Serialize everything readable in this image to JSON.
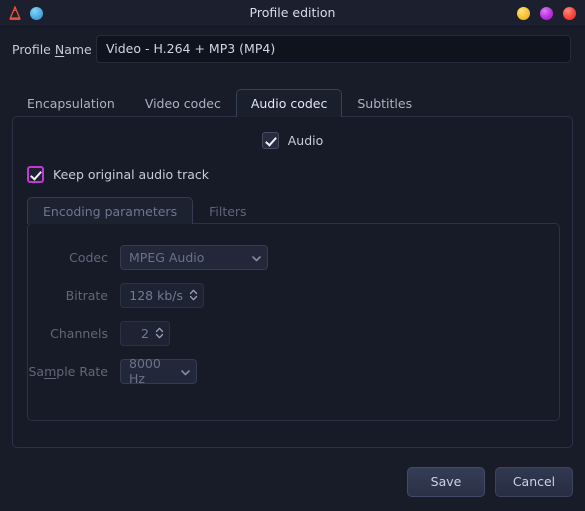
{
  "window": {
    "title": "Profile edition",
    "app_icon": "vlc-cone-icon",
    "secondary_icon": "blue-circle-icon",
    "controls": [
      {
        "name": "minimize-button",
        "color": "#f7c231"
      },
      {
        "name": "maximize-button",
        "color": "#bb2ee0"
      },
      {
        "name": "close-button",
        "color": "#f7453a"
      }
    ]
  },
  "profile": {
    "label_prefix": "Profile ",
    "label_mnemonic": "N",
    "label_suffix": "ame",
    "value": "Video - H.264 + MP3 (MP4)",
    "placeholder": ""
  },
  "tabs": [
    {
      "label": "Encapsulation",
      "active": false
    },
    {
      "label": "Video codec",
      "active": false
    },
    {
      "label": "Audio codec",
      "active": true
    },
    {
      "label": "Subtitles",
      "active": false
    }
  ],
  "audio": {
    "enable_label": "Audio",
    "enable_checked": true,
    "keep_original_label": "Keep original audio track",
    "keep_original_checked": true,
    "keep_original_focused": true,
    "focus_color": "#c436d8"
  },
  "subtabs": [
    {
      "label": "Encoding parameters",
      "active": true
    },
    {
      "label": "Filters",
      "active": false
    }
  ],
  "fields": {
    "codec": {
      "label": "Codec",
      "value": "MPEG Audio",
      "type": "combobox",
      "disabled": true
    },
    "bitrate": {
      "label": "Bitrate",
      "value": "128 kb/s",
      "type": "spinbox",
      "disabled": true
    },
    "channels": {
      "label": "Channels",
      "value": "2",
      "type": "spinbox",
      "disabled": true
    },
    "sample_rate": {
      "label_prefix": "Sa",
      "label_mnemonic": "m",
      "label_suffix": "ple Rate",
      "value": "8000 Hz",
      "type": "combobox",
      "disabled": true
    }
  },
  "buttons": {
    "save": "Save",
    "cancel": "Cancel"
  }
}
